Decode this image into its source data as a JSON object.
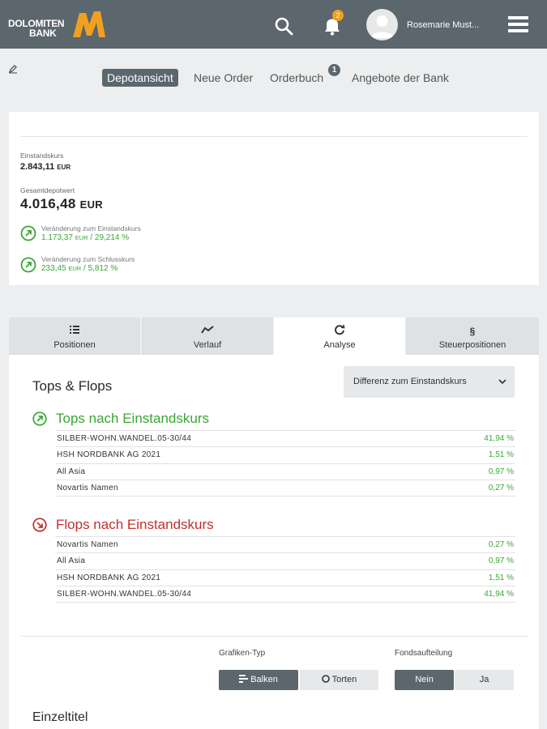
{
  "header": {
    "logo_line1": "DOLOMITEN",
    "logo_line2": "BANK",
    "notification_count": "2",
    "user_name": "Rosemarie Must...",
    "icons": [
      "search-icon",
      "bell-icon",
      "avatar",
      "menu-icon"
    ]
  },
  "subnav": {
    "items": [
      "Depotansicht",
      "Neue Order",
      "Orderbuch",
      "Angebote der Bank"
    ],
    "active": "Depotansicht",
    "orderbuch_badge": "1"
  },
  "summary": {
    "einstandskurs_label": "Einstandskurs",
    "einstandskurs_value": "2.843,11",
    "currency": "EUR",
    "gesamt_label": "Gesamtdepotwert",
    "gesamt_value": "4.016,48",
    "chg1_label": "Veränderung zum Einstandskurs",
    "chg1_abs": "1.173,37",
    "chg1_sep": " / ",
    "chg1_pct": "29,214 %",
    "chg2_label": "Veränderung zum Schlusskurs",
    "chg2_abs": "233,45",
    "chg2_pct": "5,812 %"
  },
  "tabs": [
    {
      "label": "Positionen",
      "icon": "list-icon"
    },
    {
      "label": "Verlauf",
      "icon": "line-chart-icon"
    },
    {
      "label": "Analyse",
      "icon": "refresh-icon"
    },
    {
      "label": "Steuerpositionen",
      "icon": "paragraph-icon"
    }
  ],
  "active_tab": "Analyse",
  "analyse": {
    "title": "Tops & Flops",
    "dropdown_value": "Differenz zum Einstandskurs",
    "tops_title": "Tops nach Einstandskurs",
    "tops": [
      {
        "name": "SILBER-WOHN.WANDEL.05-30/44",
        "value": "41,94 %"
      },
      {
        "name": "HSH NORDBANK AG 2021",
        "value": "1,51 %"
      },
      {
        "name": "All Asia",
        "value": "0,97 %"
      },
      {
        "name": "Novartis Namen",
        "value": "0,27 %"
      }
    ],
    "flops_title": "Flops nach Einstandskurs",
    "flops": [
      {
        "name": "Novartis Namen",
        "value": "0,27 %"
      },
      {
        "name": "All Asia",
        "value": "0,97 %"
      },
      {
        "name": "HSH NORDBANK AG 2021",
        "value": "1,51 %"
      },
      {
        "name": "SILBER-WOHN.WANDEL.05-30/44",
        "value": "41,94 %"
      }
    ],
    "grafik_label": "Grafiken-Typ",
    "grafik_options": [
      "Balken",
      "Torten"
    ],
    "grafik_selected": "Balken",
    "fonds_label": "Fondsaufteilung",
    "fonds_options": [
      "Nein",
      "Ja"
    ],
    "fonds_selected": "Nein",
    "einzeltitel": "Einzeltitel"
  },
  "colors": {
    "header_bg": "#5b666d",
    "accent_orange": "#f0a020",
    "positive_green": "#3aa635",
    "negative_red": "#c0312b"
  }
}
